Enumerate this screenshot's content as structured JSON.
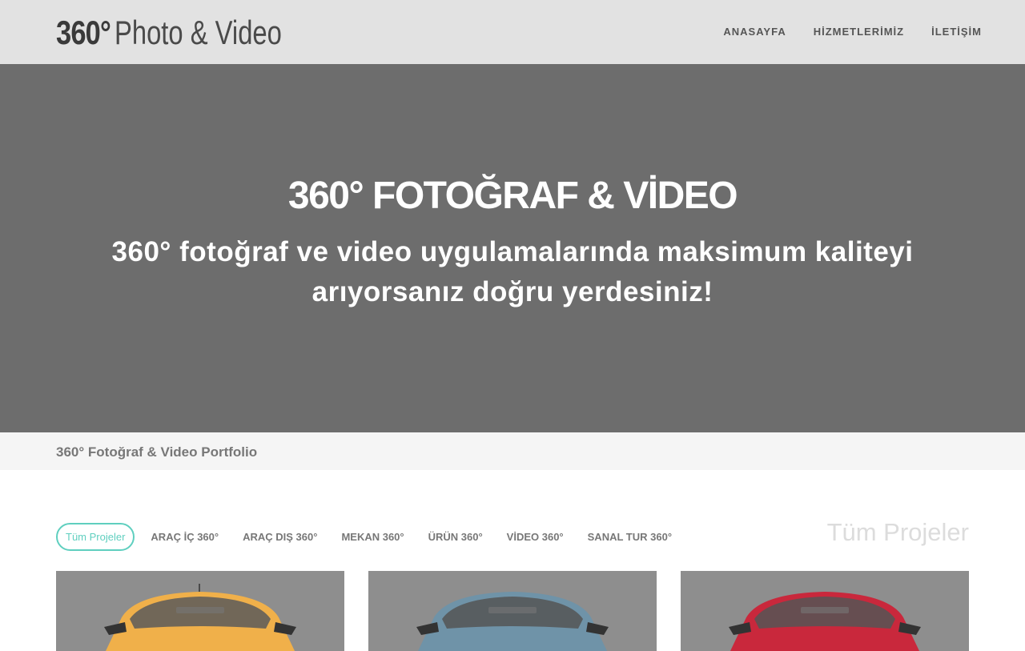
{
  "logo": {
    "strong": "360°",
    "light": "Photo & Video"
  },
  "nav": [
    {
      "label": "ANASAYFA"
    },
    {
      "label": "HİZMETLERİMİZ"
    },
    {
      "label": "İLETİŞİM"
    }
  ],
  "hero": {
    "title": "360° FOTOĞRAF & VİDEO",
    "subtitle": "360° fotoğraf ve video uygulamalarında maksimum kaliteyi arıyorsanız doğru yerdesiniz!"
  },
  "breadcrumb": "360° Fotoğraf & Video Portfolio",
  "filters": [
    {
      "label": "Tüm Projeler",
      "active": true
    },
    {
      "label": "ARAÇ İÇ 360°"
    },
    {
      "label": "ARAÇ DIŞ 360°"
    },
    {
      "label": "MEKAN 360°"
    },
    {
      "label": "ÜRÜN 360°"
    },
    {
      "label": "VİDEO 360°"
    },
    {
      "label": "SANAL TUR 360°"
    }
  ],
  "section_label": "Tüm Projeler",
  "cards": [
    {
      "car_color": "#f0b04a"
    },
    {
      "car_color": "#6f93a8"
    },
    {
      "car_color": "#c9283c"
    }
  ],
  "colors": {
    "header_bg": "#e2e2e2",
    "hero_bg": "#6d6d6d",
    "accent": "#5fcfbf",
    "card_bg": "#8e8e8e"
  }
}
